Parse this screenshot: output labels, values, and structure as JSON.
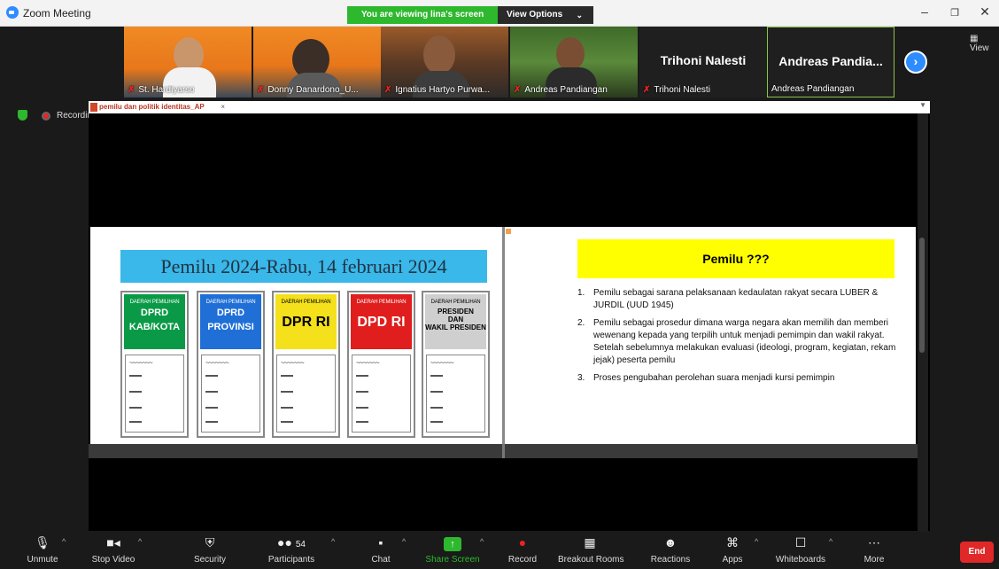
{
  "app": {
    "title": "Zoom Meeting",
    "viewing_banner": "You are viewing lina's screen",
    "view_options": "View Options",
    "view_link": "View"
  },
  "tiles": [
    {
      "name": "St. Hardiyarso",
      "muted": true
    },
    {
      "name": "Donny Danardono_U...",
      "muted": true
    },
    {
      "name": "Ignatius Hartyo Purwa...",
      "muted": true
    },
    {
      "name": "Andreas Pandiangan",
      "muted": true
    },
    {
      "name": "Trihoni Nalesti",
      "muted": true,
      "display": "Trihoni Nalesti"
    },
    {
      "name": "Andreas Pandiangan",
      "muted": false,
      "display": "Andreas  Pandia..."
    }
  ],
  "recording_label": "Recording",
  "share": {
    "tab_title": "pemilu dan politik identitas_AP",
    "tab_close": "×"
  },
  "slide1": {
    "title": "Pemilu 2024-Rabu, 14 februari 2024",
    "boxes": [
      {
        "label": "DAERAH PEMILIHAN",
        "name": "DPRD KAB/KOTA",
        "line1": "DPRD",
        "line2": "KAB/KOTA",
        "color": "#0a9a47",
        "text": "#ffffff"
      },
      {
        "label": "DAERAH PEMILIHAN",
        "name": "DPRD PROVINSI",
        "line1": "DPRD",
        "line2": "PROVINSI",
        "color": "#1f6fd6",
        "text": "#ffffff"
      },
      {
        "label": "DAERAH PEMILIHAN",
        "name": "DPR RI",
        "line1": "DPR RI",
        "line2": "",
        "color": "#f4e01b",
        "text": "#000000"
      },
      {
        "label": "DAERAH PEMILIHAN",
        "name": "DPD RI",
        "line1": "DPD RI",
        "line2": "",
        "color": "#e01e1e",
        "text": "#ffffff"
      },
      {
        "label": "DAERAH PEMILIHAN",
        "name": "PRESIDEN DAN WAKIL PRESIDEN",
        "line1": "PRESIDEN",
        "line2": "DAN",
        "line3": "WAKIL PRESIDEN",
        "color": "#cfcfcf",
        "text": "#000000"
      }
    ]
  },
  "slide2": {
    "title": "Pemilu ???",
    "items": [
      {
        "num": "1.",
        "text": "Pemilu sebagai sarana pelaksanaan kedaulatan rakyat secara LUBER & JURDIL (UUD 1945)"
      },
      {
        "num": "2.",
        "text": "Pemilu sebagai prosedur dimana warga negara akan memilih dan memberi wewenang kepada yang terpilih untuk menjadi pemimpin dan wakil rakyat. Setelah sebelumnya melakukan evaluasi (ideologi, program, kegiatan, rekam jejak) peserta pemilu"
      },
      {
        "num": "3.",
        "text": "Proses pengubahan perolehan suara menjadi kursi pemimpin"
      }
    ]
  },
  "toolbar": {
    "unmute": "Unmute",
    "stop_video": "Stop Video",
    "security": "Security",
    "participants": "Participants",
    "participants_count": "54",
    "chat": "Chat",
    "share_screen": "Share Screen",
    "record": "Record",
    "breakout": "Breakout Rooms",
    "reactions": "Reactions",
    "apps": "Apps",
    "whiteboards": "Whiteboards",
    "more": "More",
    "end": "End"
  }
}
